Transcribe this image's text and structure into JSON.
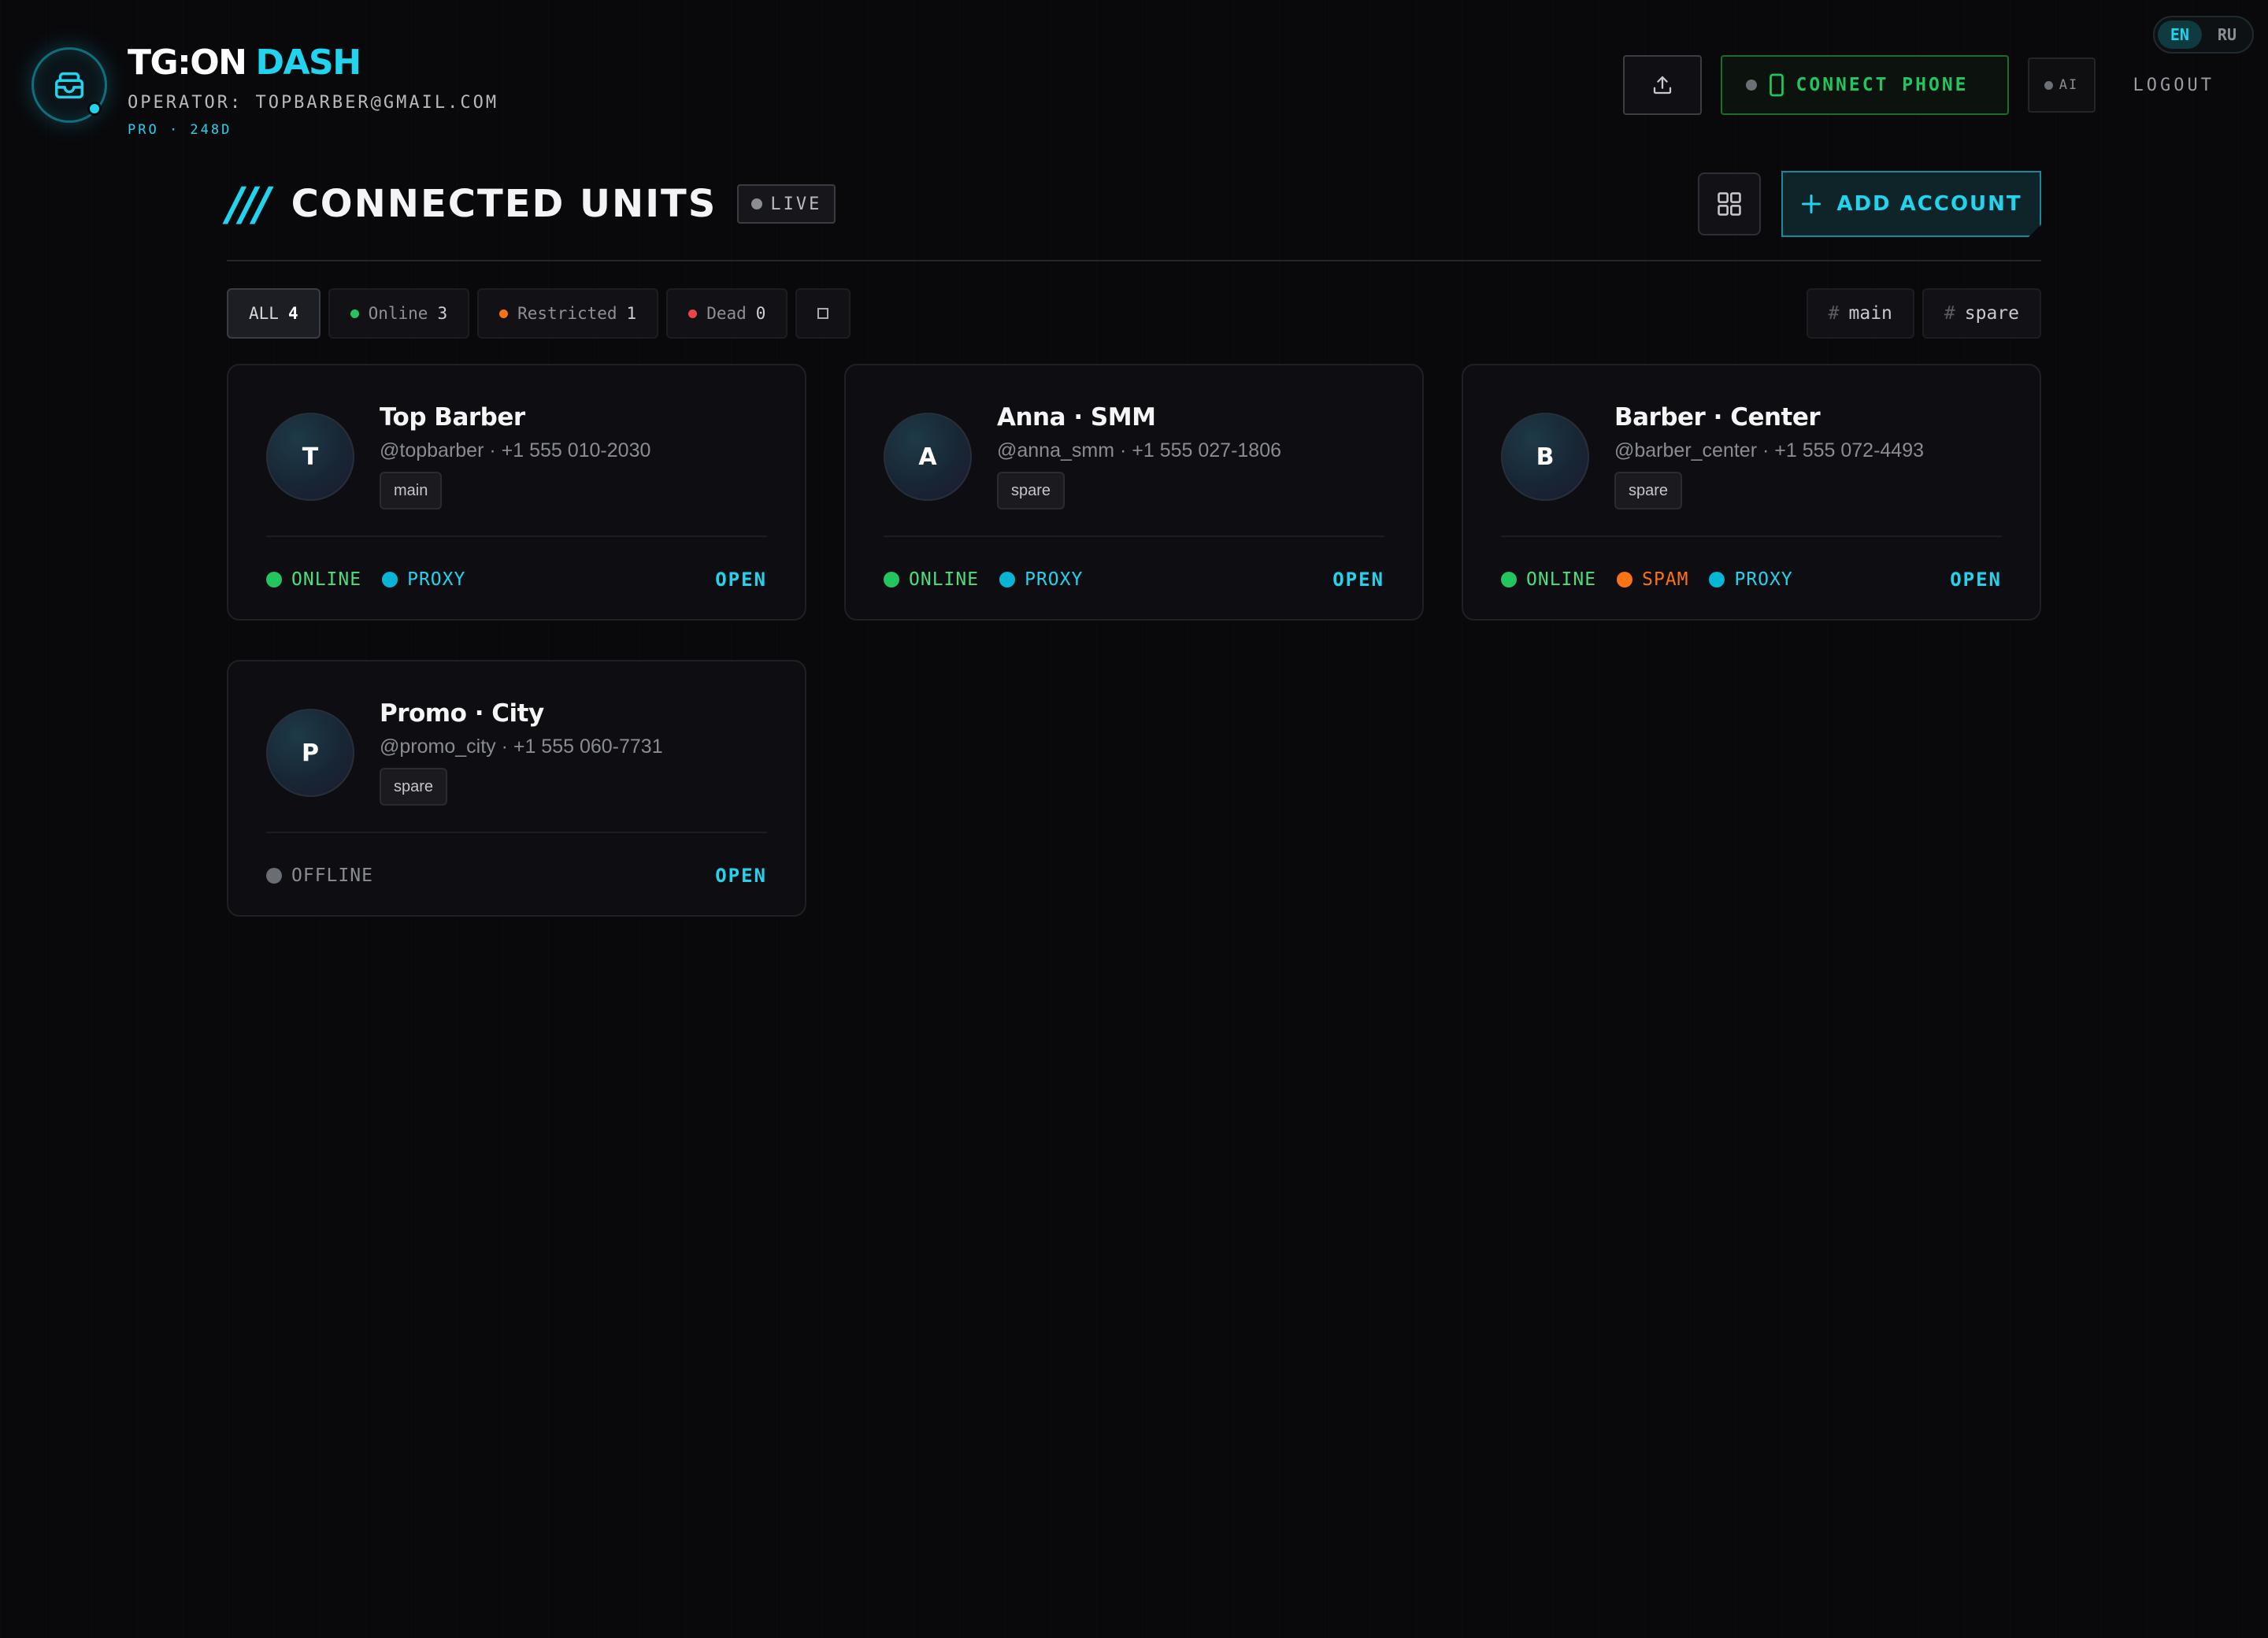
{
  "brand": {
    "title_white": "TG:ON",
    "title_cyan": "DASH",
    "operator": "OPERATOR: TOPBARBER@GMAIL.COM",
    "plan": "PRO · 248D",
    "logo_icon": "inbox-icon"
  },
  "language": {
    "options": [
      "EN",
      "RU"
    ],
    "active": "EN"
  },
  "toolbar": {
    "upload_icon": "upload-icon",
    "connect_phone_label": "CONNECT PHONE",
    "ai_label": "AI",
    "logout_label": "LOGOUT"
  },
  "section": {
    "slashes": "///",
    "title": "CONNECTED UNITS",
    "live_label": "LIVE",
    "add_account_label": "ADD ACCOUNT",
    "grid_icon": "grid-view-icon"
  },
  "filters": {
    "all": {
      "label": "ALL",
      "count": "4"
    },
    "online": {
      "label": "Online",
      "count": "3"
    },
    "restricted": {
      "label": "Restricted",
      "count": "1"
    },
    "dead": {
      "label": "Dead",
      "count": "0"
    },
    "tags": [
      "main",
      "spare"
    ]
  },
  "accounts": [
    {
      "initial": "T",
      "name": "Top Barber",
      "meta": "@topbarber · +1 555 010-2030",
      "tag": "main",
      "statuses": [
        "ONLINE",
        "PROXY"
      ],
      "open_label": "OPEN"
    },
    {
      "initial": "A",
      "name": "Anna · SMM",
      "meta": "@anna_smm · +1 555 027-1806",
      "tag": "spare",
      "statuses": [
        "ONLINE",
        "PROXY"
      ],
      "open_label": "OPEN"
    },
    {
      "initial": "B",
      "name": "Barber · Center",
      "meta": "@barber_center · +1 555 072-4493",
      "tag": "spare",
      "statuses": [
        "ONLINE",
        "SPAM",
        "PROXY"
      ],
      "open_label": "OPEN"
    },
    {
      "initial": "P",
      "name": "Promo · City",
      "meta": "@promo_city · +1 555 060-7731",
      "tag": "spare",
      "statuses": [
        "OFFLINE"
      ],
      "open_label": "OPEN"
    }
  ],
  "colors": {
    "accent": "#22d3ee",
    "online": "#22c55e",
    "restricted": "#f97316",
    "dead": "#ef4444",
    "offline": "#6b6d74",
    "background": "#09090c"
  }
}
